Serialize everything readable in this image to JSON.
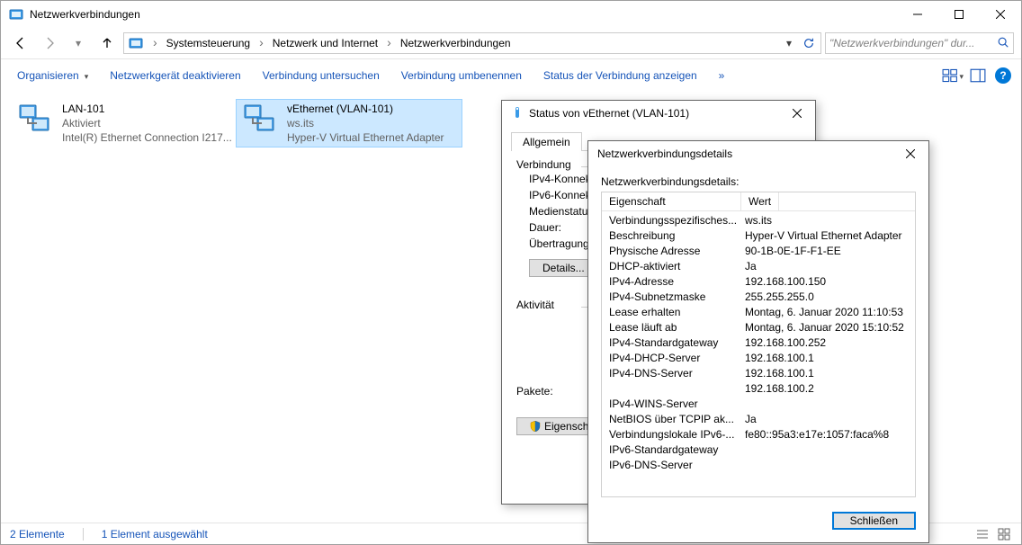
{
  "window": {
    "title": "Netzwerkverbindungen"
  },
  "address": {
    "segments": [
      "Systemsteuerung",
      "Netzwerk und Internet",
      "Netzwerkverbindungen"
    ]
  },
  "search": {
    "placeholder": "\"Netzwerkverbindungen\" dur..."
  },
  "cmdbar": {
    "organize": "Organisieren",
    "disable": "Netzwerkgerät deaktivieren",
    "diagnose": "Verbindung untersuchen",
    "rename": "Verbindung umbenennen",
    "status": "Status der Verbindung anzeigen",
    "more": "»"
  },
  "adapters": [
    {
      "name": "LAN-101",
      "status": "Aktiviert",
      "device": "Intel(R) Ethernet Connection I217..."
    },
    {
      "name": "vEthernet (VLAN-101)",
      "status": "ws.its",
      "device": "Hyper-V Virtual Ethernet Adapter"
    }
  ],
  "statusbar": {
    "count": "2 Elemente",
    "selection": "1 Element ausgewählt"
  },
  "statusDlg": {
    "title": "Status von vEthernet (VLAN-101)",
    "tab": "Allgemein",
    "group1": "Verbindung",
    "rows": {
      "ipv4": "IPv4-Konnek",
      "ipv6": "IPv6-Konnek",
      "media": "Medienstatus",
      "duration": "Dauer:",
      "speed": "Übertragung"
    },
    "detailsBtn": "Details...",
    "group2": "Aktivität",
    "packets": "Pakete:",
    "propsBtn": "Eigenscha"
  },
  "detailsDlg": {
    "title": "Netzwerkverbindungsdetails",
    "label": "Netzwerkverbindungsdetails:",
    "head": {
      "prop": "Eigenschaft",
      "val": "Wert"
    },
    "rows": [
      {
        "p": "Verbindungsspezifisches...",
        "v": "ws.its"
      },
      {
        "p": "Beschreibung",
        "v": "Hyper-V Virtual Ethernet Adapter"
      },
      {
        "p": "Physische Adresse",
        "v": "90-1B-0E-1F-F1-EE"
      },
      {
        "p": "DHCP-aktiviert",
        "v": "Ja"
      },
      {
        "p": "IPv4-Adresse",
        "v": "192.168.100.150"
      },
      {
        "p": "IPv4-Subnetzmaske",
        "v": "255.255.255.0"
      },
      {
        "p": "Lease erhalten",
        "v": "Montag, 6. Januar 2020 11:10:53"
      },
      {
        "p": "Lease läuft ab",
        "v": "Montag, 6. Januar 2020 15:10:52"
      },
      {
        "p": "IPv4-Standardgateway",
        "v": "192.168.100.252"
      },
      {
        "p": "IPv4-DHCP-Server",
        "v": "192.168.100.1"
      },
      {
        "p": "IPv4-DNS-Server",
        "v": "192.168.100.1"
      },
      {
        "p": "",
        "v": "192.168.100.2"
      },
      {
        "p": "IPv4-WINS-Server",
        "v": ""
      },
      {
        "p": "NetBIOS über TCPIP ak...",
        "v": "Ja"
      },
      {
        "p": "Verbindungslokale IPv6-...",
        "v": "fe80::95a3:e17e:1057:faca%8"
      },
      {
        "p": "IPv6-Standardgateway",
        "v": ""
      },
      {
        "p": "IPv6-DNS-Server",
        "v": ""
      }
    ],
    "closeBtn": "Schließen"
  }
}
